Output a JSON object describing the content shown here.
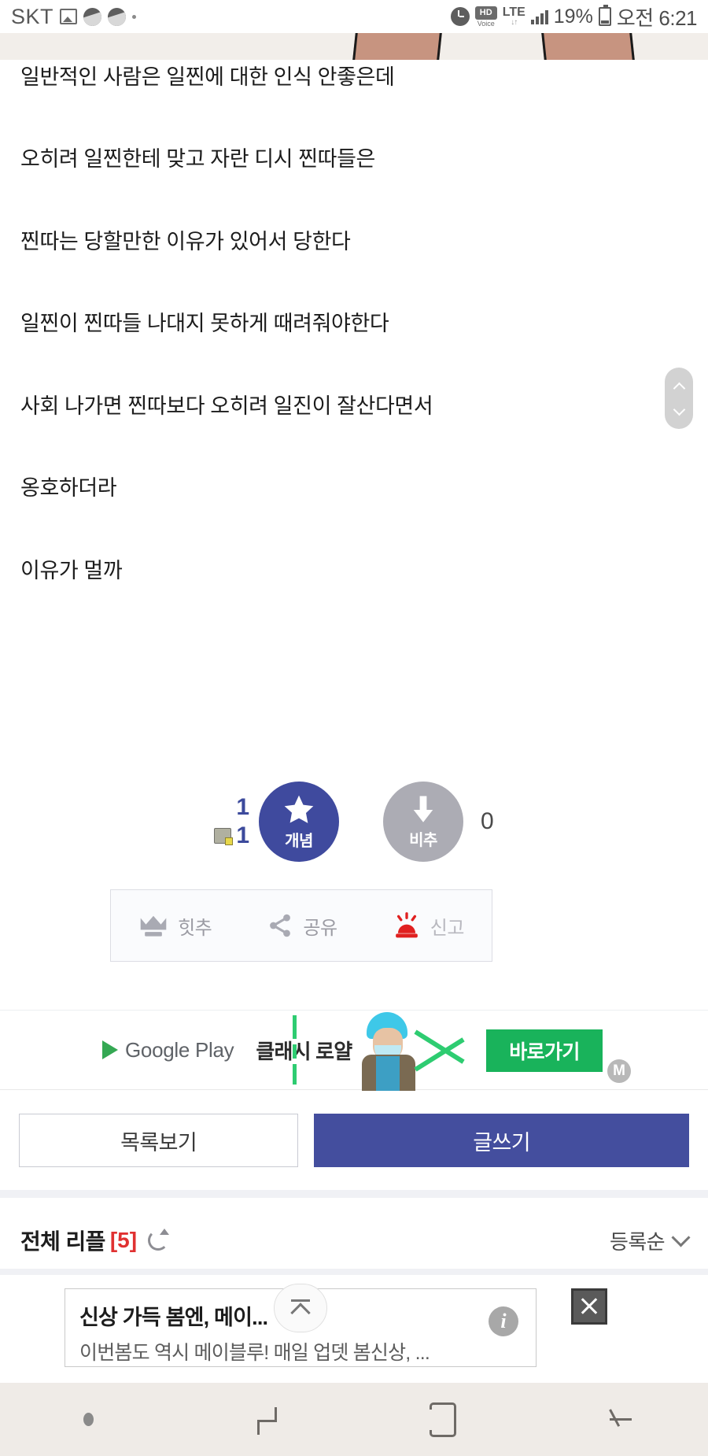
{
  "status_bar": {
    "carrier": "SKT",
    "battery_percent": "19%",
    "time": "오전 6:21",
    "network": "LTE",
    "voice": "HD",
    "voice_sub": "Voice",
    "icons": [
      "image-icon",
      "blob-icon",
      "blob-icon",
      "dot-icon",
      "alarm-icon",
      "hd-voice-icon",
      "lte-icon",
      "signal-icon",
      "battery-icon"
    ]
  },
  "post": {
    "lines": [
      "일반적인 사람은 일찐에 대한 인식 안좋은데",
      "오히려 일찐한테 맞고 자란 디시 찐따들은",
      "찐따는 당할만한 이유가 있어서 당한다",
      "일찐이 찐따들 나대지 못하게 때려줘야한다",
      "사회 나가면 찐따보다 오히려 일진이 잘산다면서",
      "옹호하더라",
      "이유가 멀까"
    ]
  },
  "vote": {
    "up_count": "1",
    "secondary_count": "1",
    "up_label": "개념",
    "down_label": "비추",
    "down_count": "0",
    "up_color": "#3f4a9e",
    "down_color": "#acacb4"
  },
  "actions": [
    {
      "label": "힛추",
      "icon": "crown-icon"
    },
    {
      "label": "공유",
      "icon": "share-icon"
    },
    {
      "label": "신고",
      "icon": "siren-icon"
    }
  ],
  "google_ad": {
    "store": "Google Play",
    "title": "클래시 로얄",
    "cta": "바로가기",
    "marker": "M",
    "accent": "#19b35b"
  },
  "nav_buttons": {
    "list": "목록보기",
    "write": "글쓰기",
    "write_color": "#444e9e"
  },
  "comments": {
    "title": "전체 리플",
    "count": "[5]",
    "count_color": "#e03131",
    "sort": "등록순"
  },
  "bottom_ad": {
    "title": "신상 가득 봄엔, 메이...",
    "subtitle": "이번봄도 역시 메이블루! 매일 업뎃 봄신상, ...",
    "info": "i"
  },
  "bottom_nav": {
    "items": [
      "dot-icon",
      "recents-icon",
      "home-icon",
      "back-icon"
    ]
  }
}
